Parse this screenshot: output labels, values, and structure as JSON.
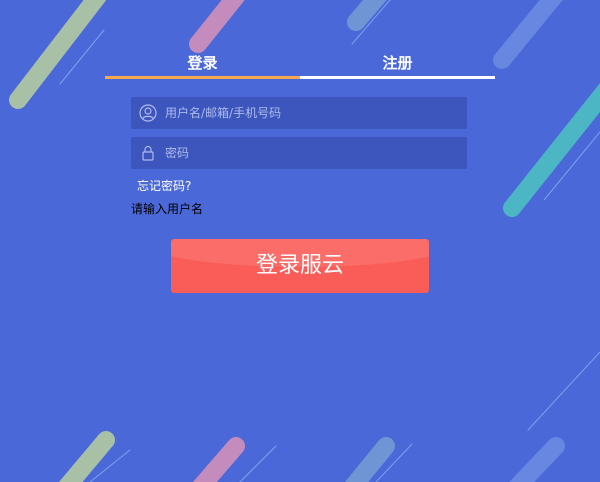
{
  "tabs": [
    {
      "label": "登录",
      "active": true
    },
    {
      "label": "注册",
      "active": false
    }
  ],
  "form": {
    "username": {
      "placeholder": "用户名/邮箱/手机号码",
      "value": "",
      "icon": "user-icon"
    },
    "password": {
      "placeholder": "密码",
      "value": "",
      "icon": "lock-icon"
    },
    "forgot_label": "忘记密码?",
    "error_message": "请输入用户名",
    "submit_label": "登录服云"
  },
  "colors": {
    "background": "#4a68d8",
    "active_tab_underline": "#f4a94e",
    "submit_button": "#fa5d57"
  }
}
